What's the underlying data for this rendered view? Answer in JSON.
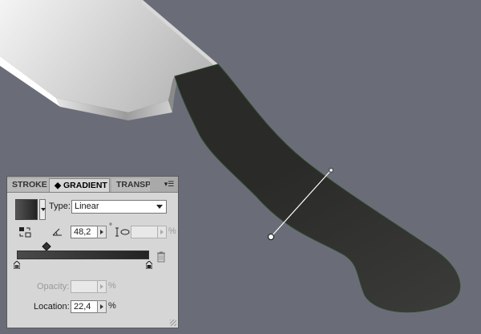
{
  "panel": {
    "tabs": [
      {
        "label": "STROKE"
      },
      {
        "label": "GRADIENT",
        "prefix": "◆"
      },
      {
        "label": "TRANSPA"
      }
    ],
    "menu_icon": "panel-menu-icon",
    "type_label": "Type:",
    "type_value": "Linear",
    "angle_value": "48,2",
    "degree_symbol": "°",
    "aspect_value": "",
    "aspect_unit": "%",
    "opacity_label": "Opacity:",
    "opacity_value": "",
    "opacity_unit": "%",
    "location_label": "Location:",
    "location_value": "22,4",
    "location_unit": "%"
  },
  "colors": {
    "canvas_bg": "#6a6d78",
    "handle": "#2c2d2b",
    "blade_light": "#f2f2f2",
    "blade_dark": "#a8a8a8",
    "handle_outline": "#3f5a3a"
  }
}
